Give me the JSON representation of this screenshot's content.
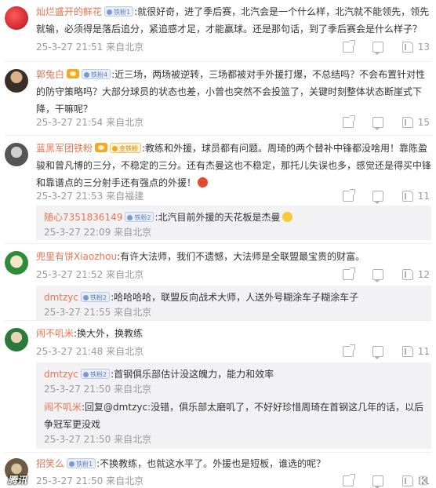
{
  "comments": [
    {
      "user": "灿烂盛开的鲜花",
      "badge": "铁粉1",
      "text": ":就很好奇，进了季后赛，北汽会是一个什么样，北汽就不能领先，领先就输，必须得是落后追分，紧追感才足，才能赢球。还是那句话，到了季后赛会是什么样子？",
      "time": "25-3-27 21:51",
      "source": "来自北京",
      "likes": "13"
    },
    {
      "user": "郭兔白",
      "badge": "铁粉4",
      "text": ":近三场，两场被逆转，三场都被对手外援打爆，不总结吗？不会布置针对性的防守策略吗？大部分球员的状态也差，小曾也突然不会投篮了，关键时刻整体状态断崖式下降，干嘛呢？",
      "time": "25-3-27 21:54",
      "source": "来自北京",
      "likes": "15"
    },
    {
      "user": "蓝黑军团铁粉",
      "badge": "金铁粉",
      "text": ":教练和外援，球员都有问题。周琦的两个替补中锋都没啥用！靠陈盈骏和曾凡博的三分，不稳定的三分。还有杰曼这也不稳定，那托儿失误也多，感觉还是得买中锋和靠谱点的三分射手还有强点的外援！",
      "time": "25-3-27 21:53",
      "source": "来自福建",
      "likes": "11",
      "reply": {
        "user": "随心7351836149",
        "badge": "铁粉2",
        "text": ":北汽目前外援的天花板是杰曼",
        "time": "25-3-27 22:09",
        "source": "来自北京"
      }
    },
    {
      "user": "兜里有饼Xiaozhou",
      "text": ":有许大法师，我们不遗憾，大法师是全联盟最宝贵的财富。",
      "time": "25-3-27 21:52",
      "source": "来自北京",
      "likes": "12",
      "reply": {
        "user": "dmtzyc",
        "badge": "铁粉2",
        "text": ":哈哈哈哈，联盟反向战术大师，人送外号糊涂车子糊涂车子",
        "time": "25-3-27 21:55",
        "source": "来自北京"
      }
    },
    {
      "user": "闹不叽米",
      "text": ":换大外，换教练",
      "time": "25-3-27 21:48",
      "source": "来自北京",
      "likes": "11",
      "reply": {
        "user": "dmtzyc",
        "badge": "铁粉2",
        "text": ":首钢俱乐部估计没这魄力，能力和效率",
        "time": "25-3-27 21:50",
        "source": "来自北京"
      },
      "reply2": {
        "user": "闹不叽米",
        "text": ":回复@dmtzyc:没错，俱乐部太磨叽了，不好好珍惜周琦在首钢这几年的话，以后争冠军更没戏",
        "time": "25-3-27 21:50",
        "source": "来自北京"
      }
    },
    {
      "user": "招笑么",
      "badge": "铁粉1",
      "text": ":不换教练，也就这水平了。外援也是短板，谁选的呢？",
      "time": "25-3-27 21:50",
      "source": "来自北京",
      "likes": "11"
    }
  ],
  "watermark": "腾讯",
  "watermark_right": "K"
}
